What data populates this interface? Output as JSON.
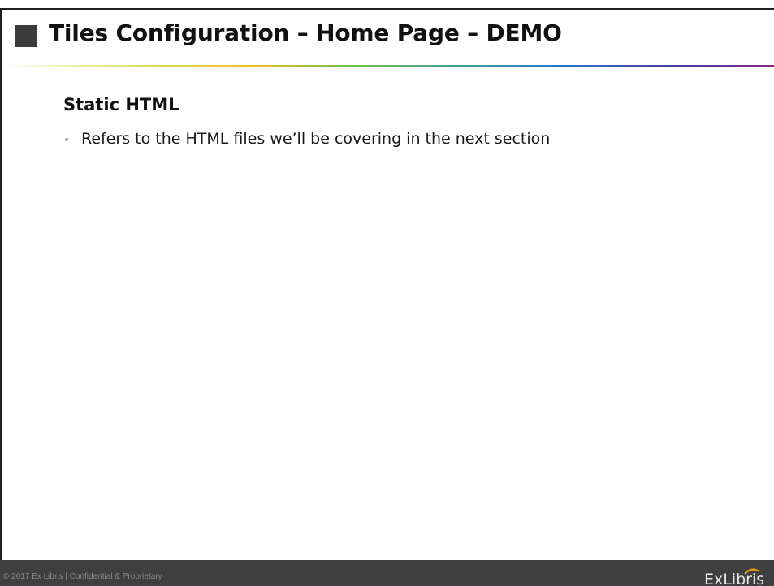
{
  "slide": {
    "title": "Tiles Configuration – Home Page – DEMO",
    "subtitle": "Static HTML",
    "bullets": [
      "Refers to the HTML files we’ll be covering in the next section"
    ]
  },
  "footer": {
    "copyright": "© 2017 Ex Libris | Confidential & Proprietary",
    "logo_text": "ExLibris"
  },
  "colors": {
    "footer_bg": "#3f3f3f",
    "title_block": "#3b3b3b",
    "logo_arc": "#f29b1d"
  }
}
